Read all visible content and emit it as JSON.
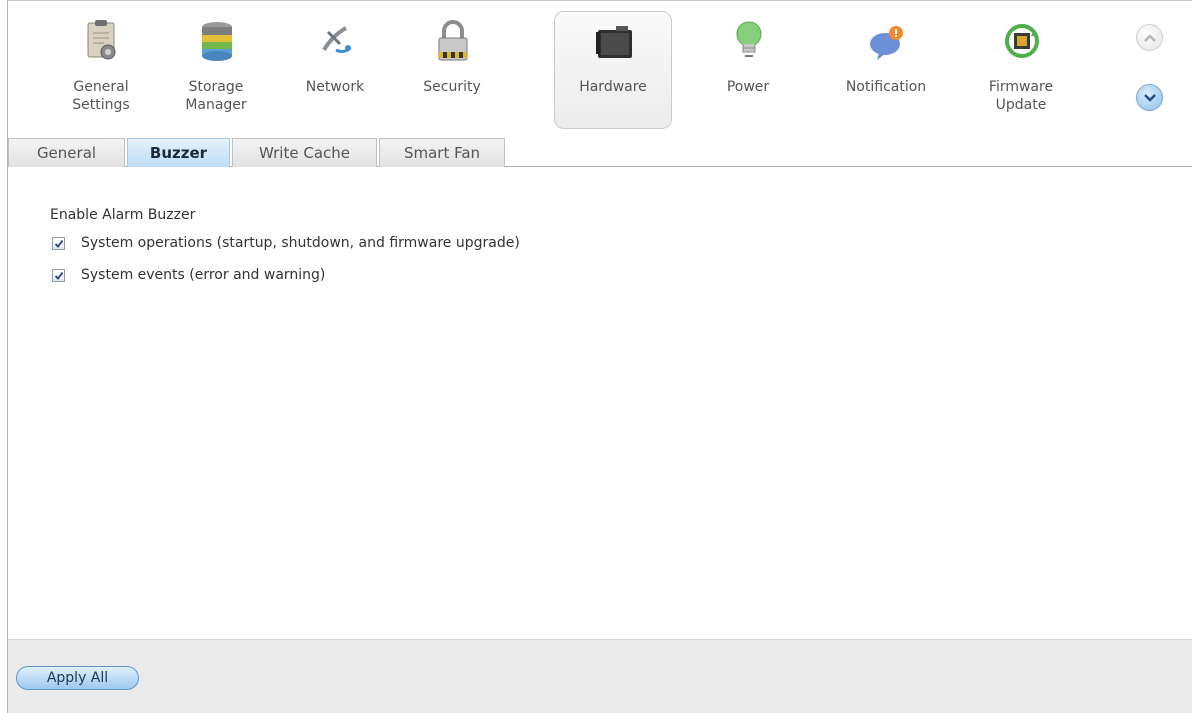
{
  "toolbar": {
    "items": [
      {
        "label": "General\nSettings",
        "icon": "general-settings-icon"
      },
      {
        "label": "Storage\nManager",
        "icon": "storage-manager-icon"
      },
      {
        "label": "Network",
        "icon": "network-icon"
      },
      {
        "label": "Security",
        "icon": "security-lock-icon"
      },
      {
        "label": "Hardware",
        "icon": "hardware-icon",
        "active": true
      },
      {
        "label": "Power",
        "icon": "power-bulb-icon"
      },
      {
        "label": "Notification",
        "icon": "notification-icon"
      },
      {
        "label": "Firmware\nUpdate",
        "icon": "firmware-update-icon"
      }
    ],
    "nav_up_icon": "chevron-up-icon",
    "nav_down_icon": "chevron-down-icon"
  },
  "tabs": [
    {
      "label": "General"
    },
    {
      "label": "Buzzer",
      "active": true
    },
    {
      "label": "Write Cache"
    },
    {
      "label": "Smart Fan"
    }
  ],
  "buzzer": {
    "section_title": "Enable Alarm Buzzer",
    "options": [
      {
        "label": "System operations (startup, shutdown, and firmware upgrade)",
        "checked": true
      },
      {
        "label": "System events (error and warning)",
        "checked": true
      }
    ]
  },
  "footer": {
    "apply_label": "Apply All"
  },
  "colors": {
    "accent": "#9cc9ef",
    "active_tab": "#bcdcf5",
    "footer_bg": "#eaeaea"
  }
}
